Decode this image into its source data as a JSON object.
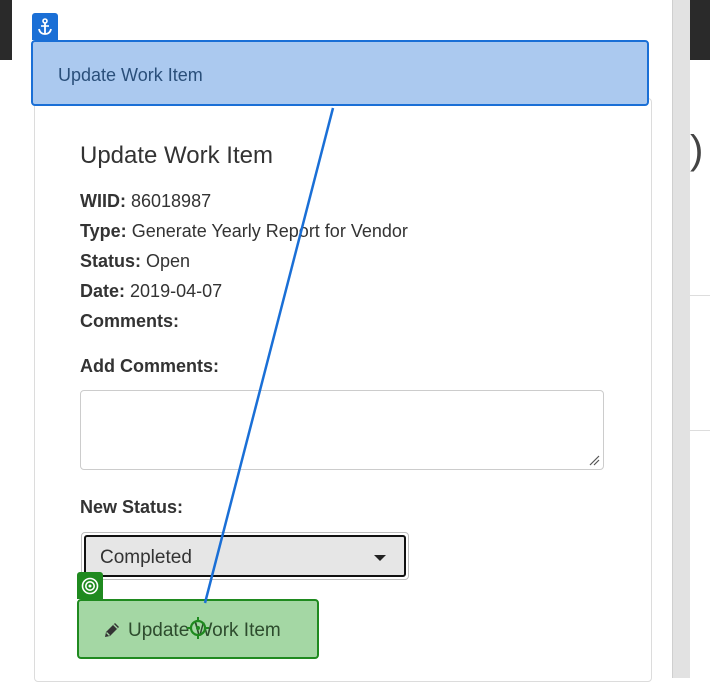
{
  "header": {
    "highlight_title": "Update Work Item"
  },
  "panel": {
    "title": "Update Work Item",
    "fields": {
      "wiid_label": "WIID:",
      "wiid_value": "86018987",
      "type_label": "Type:",
      "type_value": "Generate Yearly Report for Vendor",
      "status_label": "Status:",
      "status_value": "Open",
      "date_label": "Date:",
      "date_value": "2019-04-07",
      "comments_label": "Comments:"
    },
    "add_comments_label": "Add Comments:",
    "add_comments_value": "",
    "new_status_label": "New Status:",
    "new_status_value": "Completed",
    "submit_label": "Update Work Item"
  },
  "background_glyph": ")",
  "icons": {
    "anchor": "anchor-icon",
    "target": "target-icon",
    "pencil": "pencil-icon",
    "caret": "caret-down-icon",
    "crosshair": "crosshair-icon"
  },
  "colors": {
    "anchor_highlight": "#1a6fd6",
    "anchor_fill": "#abc9ef",
    "target_highlight": "#1f8a1f",
    "target_fill": "#a4d7a4"
  }
}
